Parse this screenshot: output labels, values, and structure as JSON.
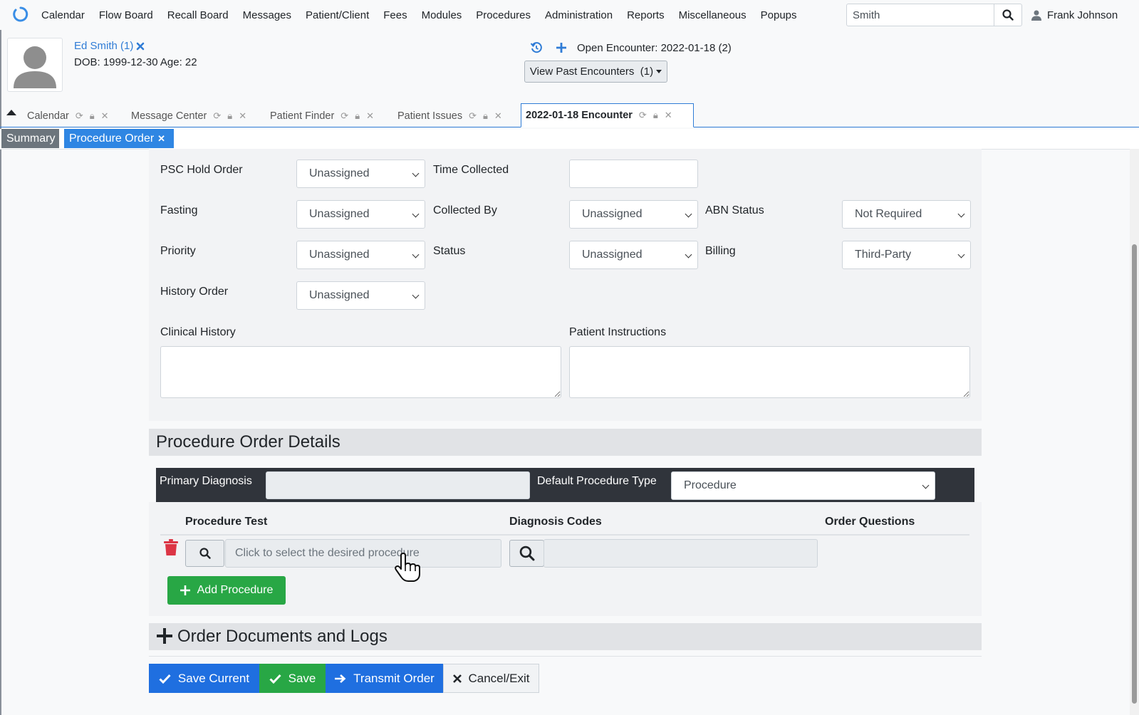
{
  "navbar": {
    "items": [
      "Calendar",
      "Flow Board",
      "Recall Board",
      "Messages",
      "Patient/Client",
      "Fees",
      "Modules",
      "Procedures",
      "Administration",
      "Reports",
      "Miscellaneous",
      "Popups"
    ],
    "search_value": "Smith",
    "user_name": "Frank Johnson"
  },
  "patient": {
    "name": "Ed Smith (1)",
    "dob_line": "DOB: 1999-12-30 Age: 22"
  },
  "encounter": {
    "open_text": "Open Encounter: 2022-01-18 (2)",
    "past_label": "View Past Encounters",
    "past_count": "(1)"
  },
  "tabs": [
    "Calendar",
    "Message Center",
    "Patient Finder",
    "Patient Issues"
  ],
  "active_tab": "2022-01-18 Encounter",
  "subtabs": {
    "summary": "Summary",
    "procedure_order": "Procedure Order"
  },
  "form": {
    "psc_hold_order": {
      "label": "PSC Hold Order",
      "value": "Unassigned"
    },
    "time_collected": {
      "label": "Time Collected",
      "value": ""
    },
    "fasting": {
      "label": "Fasting",
      "value": "Unassigned"
    },
    "collected_by": {
      "label": "Collected By",
      "value": "Unassigned"
    },
    "abn_status": {
      "label": "ABN Status",
      "value": "Not Required"
    },
    "priority": {
      "label": "Priority",
      "value": "Unassigned"
    },
    "status": {
      "label": "Status",
      "value": "Unassigned"
    },
    "billing": {
      "label": "Billing",
      "value": "Third-Party"
    },
    "history_order": {
      "label": "History Order",
      "value": "Unassigned"
    },
    "clinical_history": {
      "label": "Clinical History"
    },
    "patient_instructions": {
      "label": "Patient Instructions"
    }
  },
  "details": {
    "title": "Procedure Order Details",
    "primary_diagnosis_label": "Primary Diagnosis",
    "default_procedure_type_label": "Default Procedure Type",
    "default_procedure_type_value": "Procedure",
    "col_procedure_test": "Procedure Test",
    "col_diagnosis_codes": "Diagnosis Codes",
    "col_order_questions": "Order Questions",
    "procedure_placeholder": "Click to select the desired procedure",
    "add_procedure": "Add Procedure"
  },
  "docs": {
    "title": "Order Documents and Logs"
  },
  "footer": {
    "save_current": "Save Current",
    "save": "Save",
    "transmit": "Transmit Order",
    "cancel": "Cancel/Exit"
  },
  "colors": {
    "primary": "#1f6fe0",
    "success": "#28a745",
    "danger": "#dc3545",
    "dark": "#30343b"
  }
}
